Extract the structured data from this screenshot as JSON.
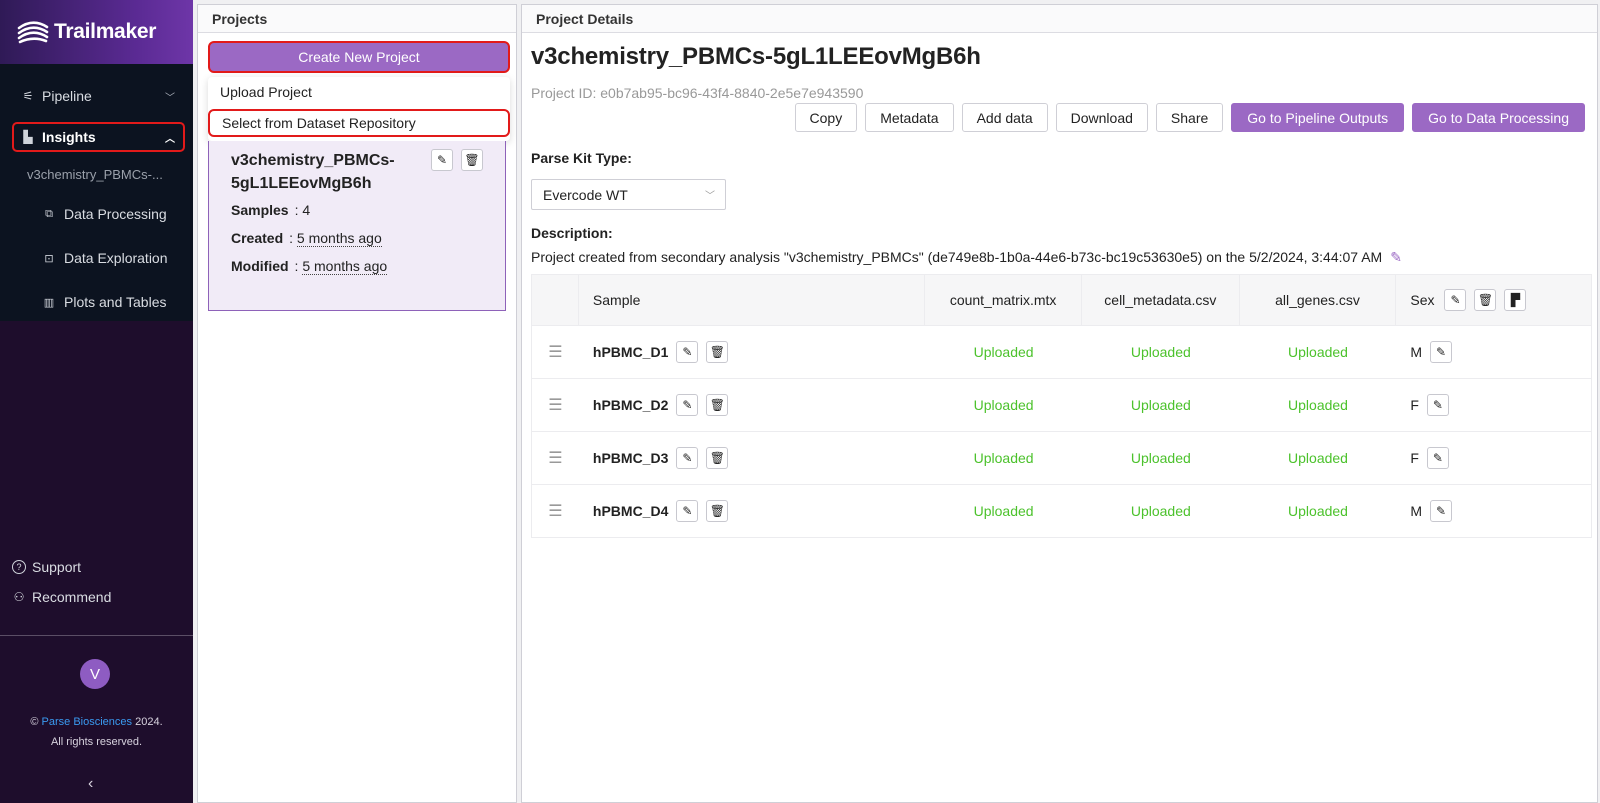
{
  "brand": {
    "name": "Trailmaker"
  },
  "sidebar": {
    "nav": [
      {
        "label": "Pipeline"
      },
      {
        "label": "Insights"
      }
    ],
    "project_short": "v3chemistry_PBMCs-...",
    "sub_items": [
      {
        "label": "Data Processing"
      },
      {
        "label": "Data Exploration"
      },
      {
        "label": "Plots and Tables"
      }
    ],
    "support_label": "Support",
    "recommend_label": "Recommend",
    "avatar_initial": "V",
    "copyright_prefix": "©",
    "copyright_link": "Parse Biosciences",
    "copyright_year": "2024.",
    "copyright_rights": "All rights reserved."
  },
  "projects_panel": {
    "header": "Projects",
    "create_label": "Create New Project",
    "dropdown": [
      "Upload Project",
      "Select from Dataset Repository"
    ],
    "card": {
      "name": "v3chemistry_PBMCs-5gL1LEEovMgB6h",
      "samples_label": "Samples",
      "samples_value": "4",
      "created_label": "Created",
      "created_value": "5 months ago",
      "modified_label": "Modified",
      "modified_value": "5 months ago"
    }
  },
  "details": {
    "header": "Project Details",
    "title": "v3chemistry_PBMCs-5gL1LEEovMgB6h",
    "project_id": "Project ID: e0b7ab95-bc96-43f4-8840-2e5e7e943590",
    "buttons": [
      "Copy",
      "Metadata",
      "Add data",
      "Download",
      "Share",
      "Go to Pipeline Outputs",
      "Go to Data Processing"
    ],
    "parse_kit_label": "Parse Kit Type:",
    "parse_kit_value": "Evercode WT",
    "description_label": "Description:",
    "description_text": "Project created from secondary analysis \"v3chemistry_PBMCs\" (de749e8b-1b0a-44e6-b73c-bc19c53630e5) on the 5/2/2024, 3:44:07 AM"
  },
  "table": {
    "columns": [
      "Sample",
      "count_matrix.mtx",
      "cell_metadata.csv",
      "all_genes.csv",
      "Sex"
    ],
    "rows": [
      {
        "sample": "hPBMC_D1",
        "count": "Uploaded",
        "meta": "Uploaded",
        "genes": "Uploaded",
        "sex": "M"
      },
      {
        "sample": "hPBMC_D2",
        "count": "Uploaded",
        "meta": "Uploaded",
        "genes": "Uploaded",
        "sex": "F"
      },
      {
        "sample": "hPBMC_D3",
        "count": "Uploaded",
        "meta": "Uploaded",
        "genes": "Uploaded",
        "sex": "F"
      },
      {
        "sample": "hPBMC_D4",
        "count": "Uploaded",
        "meta": "Uploaded",
        "genes": "Uploaded",
        "sex": "M"
      }
    ]
  },
  "colors": {
    "accent": "#9b69c4",
    "uploaded": "#4cc22c",
    "highlight": "#e21a1a",
    "sidebar_bg": "#1e0d2c"
  },
  "icons": {
    "edit": "pencil-icon",
    "delete": "trash-icon",
    "copy_format": "paint-format-icon",
    "drag": "drag-handle-icon"
  }
}
